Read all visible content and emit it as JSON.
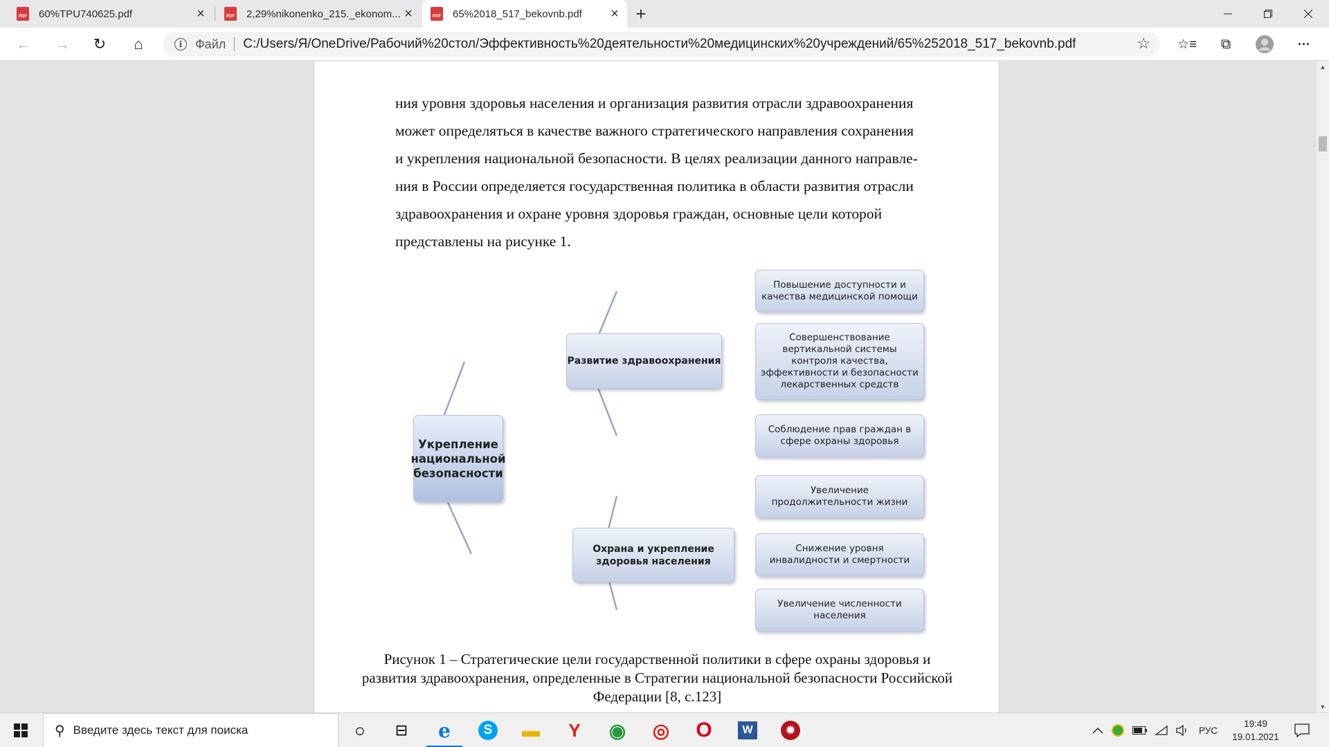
{
  "tabs": [
    {
      "title": "60%TPU740625.pdf",
      "close": "×",
      "active": false
    },
    {
      "title": "2,29%nikonenko_215._ekonom...",
      "close": "×",
      "active": false
    },
    {
      "title": "65%2018_517_bekovnb.pdf",
      "close": "×",
      "active": true
    }
  ],
  "new_tab": "+",
  "window_controls": {
    "minimize": "—",
    "maximize": "❐",
    "close": "✕"
  },
  "nav": {
    "back": "←",
    "forward": "→",
    "reload": "↻",
    "home": "⌂"
  },
  "address": {
    "info": "i",
    "scheme": "Файл",
    "url": "C:/Users/Я/OneDrive/Рабочий%20стол/Эффективность%20деятельности%20медицинских%20учреждений/65%252018_517_bekovnb.pdf",
    "favorite": "☆"
  },
  "toolbar": {
    "favorites": "☆≡",
    "collections": "⧉",
    "menu": "···"
  },
  "document": {
    "lines": [
      "ния уровня здоровья населения и организация развития отрасли здравоохранения",
      "может определяться в качестве важного стратегического направления сохранения",
      "и укрепления национальной безопасности. В целях реализации данного направле-",
      "ния в России определяется государственная политика в области развития отрасли",
      "здравоохранения и охране уровня здоровья граждан, основные цели которой",
      "представлены на рисунке 1."
    ],
    "caption": "Рисунок 1 – Стратегические цели государственной политики в сфере охраны здоровья и развития здравоохранения, определенные в Стратегии национальной безопасности Российской Федерации [8, с.123]"
  },
  "diagram": {
    "root": "Укрепление национальной безопасности",
    "branches": [
      {
        "label": "Развитие здравоохранения",
        "leaves": [
          "Повышение доступности и качества медицинской помощи",
          "Совершенствование вертикальной системы контроля качества, эффективности и безопасности лекарственных средств",
          "Соблюдение прав граждан в сфере охраны здоровья"
        ]
      },
      {
        "label": "Охрана и укрепление здоровья населения",
        "leaves": [
          "Увеличение продолжительности жизни",
          "Снижение уровня инвалидности и смертности",
          "Увеличение численности населения"
        ]
      }
    ]
  },
  "taskbar": {
    "search_placeholder": "Введите здесь текст для поиска",
    "apps": [
      {
        "name": "task-view",
        "glyph": "○"
      },
      {
        "name": "timeline",
        "glyph": "⊟"
      },
      {
        "name": "edge",
        "glyph": "e"
      },
      {
        "name": "skype",
        "glyph": "S"
      },
      {
        "name": "file-explorer",
        "glyph": "▬"
      },
      {
        "name": "yandex-browser",
        "glyph": "Y"
      },
      {
        "name": "chrome",
        "glyph": "◉"
      },
      {
        "name": "app-red-circle",
        "glyph": "◎"
      },
      {
        "name": "opera",
        "glyph": "O"
      },
      {
        "name": "word",
        "glyph": "W"
      },
      {
        "name": "app-dark-red",
        "glyph": "✹"
      }
    ],
    "lang": "РУС",
    "time": "19:49",
    "date": "19.01.2021"
  },
  "colors": {
    "edge_blue": "#0a78d4",
    "pdf_red": "#d83b3b",
    "connector": "#94a8c6"
  }
}
